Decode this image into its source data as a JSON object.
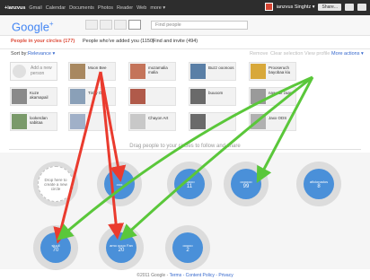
{
  "topbar": {
    "items": [
      "+ianzvus",
      "Gmail",
      "Calendar",
      "Documents",
      "Photos",
      "Reader",
      "Web",
      "more ▾"
    ],
    "user_name": "ianzvus Singhtz ▾",
    "share_label": "Share..."
  },
  "header": {
    "logo_text": "Google",
    "logo_plus": "+",
    "search_placeholder": "Find people"
  },
  "tabs": [
    "People in your circles (177)",
    "People who've added you (1150)",
    "Find and invite (494)"
  ],
  "sortbar": {
    "label": "Sort by:",
    "value": "Relevance ▾",
    "actions": [
      "Remove",
      "Clear selection",
      "View profile"
    ],
    "more_actions": "More actions ▾"
  },
  "add_person": "Add a new person",
  "people": [
    {
      "name": "Moon Bee",
      "color": "#a88860"
    },
    {
      "name": "mozamalia malia",
      "color": "#c4745a"
    },
    {
      "name": "Buzz ooonoos",
      "color": "#5a7fa6"
    },
    {
      "name": "Prooseruch bayobaa kiu",
      "color": "#d8a83a"
    },
    {
      "name": "Kuze akamapail",
      "color": "#8a8a8a"
    },
    {
      "name": "Tinky Ok",
      "color": "#8aa0b8"
    },
    {
      "name": "",
      "color": "#b05a4a"
    },
    {
      "name": "buuoom",
      "color": "#6a6a6a"
    },
    {
      "name": "nawaaz zaan",
      "color": "#9a9a9a"
    },
    {
      "name": "lookerdan sabitaa",
      "color": "#7a9a6a"
    },
    {
      "name": "",
      "color": "#a0b0c8"
    },
    {
      "name": "Chayon Art",
      "color": "#c8c8c8"
    },
    {
      "name": "",
      "color": "#6a6a6a"
    },
    {
      "name": "Jaxx ODS",
      "color": "#b0b0b0"
    },
    {
      "name": "",
      "color": "#b8a888"
    },
    {
      "name": "",
      "color": "#9a8a7a"
    },
    {
      "name": "khkk uu idak",
      "color": "#c0a070"
    }
  ],
  "drag_hint": "Drag people to your circles to follow and share",
  "empty_circle": "Drop here to create a new circle",
  "circles": [
    {
      "name": "ooo",
      "count": "",
      "color": "#4a90d9"
    },
    {
      "name": "ooooo",
      "count": "11",
      "color": "#4a90d9"
    },
    {
      "name": "oooooo",
      "count": "99",
      "color": "#4a90d9"
    },
    {
      "name": "aficionados",
      "count": "8",
      "color": "#4a90d9"
    },
    {
      "name": "siuuil",
      "count": "70",
      "color": "#4a90d9"
    },
    {
      "name": "amo oooo Fan",
      "count": "20",
      "color": "#4a90d9"
    },
    {
      "name": "ooooo",
      "count": "2",
      "color": "#4a90d9"
    }
  ],
  "footer": {
    "copyright": "©2011 Google - ",
    "links": "Terms - Content Policy - Privacy"
  },
  "annotations": {
    "red": "#ea3b2e",
    "green": "#5ac73a"
  }
}
